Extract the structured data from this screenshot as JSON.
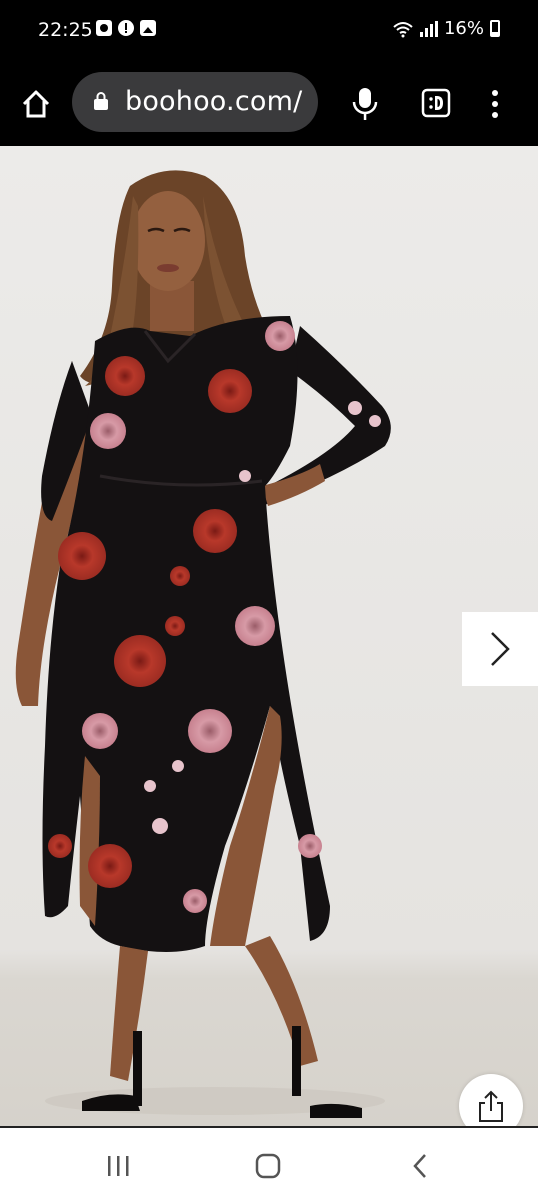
{
  "status_bar": {
    "time": "22:25",
    "battery_percent": "16%",
    "notification_icons": [
      "camera-notif-icon",
      "alert-notif-icon",
      "gallery-notif-icon"
    ]
  },
  "browser": {
    "url": "boohoo.com/",
    "icons": [
      "home-icon",
      "lock-icon",
      "mic-icon",
      "extension-icon",
      "menu-icon"
    ]
  },
  "product_gallery": {
    "image_subject": "model-in-black-floral-midi-shirt-dress",
    "next_icon": "chevron-right-icon",
    "share_icon": "share-icon"
  },
  "colors": {
    "system_bg": "#000000",
    "url_bar_bg": "#3a3a3c",
    "page_bg": "#ecebe9",
    "dress_black": "#141112",
    "flower_red": "#b8382a",
    "flower_pink": "#d79aa6"
  },
  "nav_bar": {
    "icons": [
      "recents-icon",
      "home-circle-icon",
      "back-icon"
    ]
  }
}
